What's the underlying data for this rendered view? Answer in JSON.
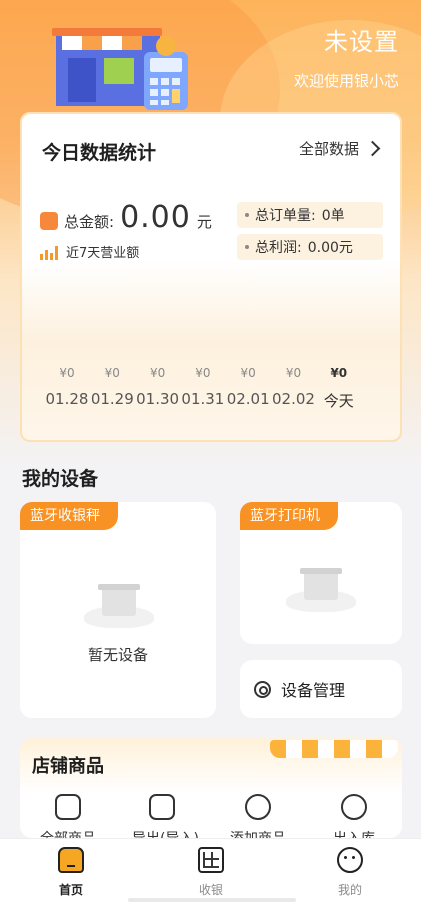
{
  "header": {
    "title": "未设置",
    "subtitle": "欢迎使用银小芯"
  },
  "stats": {
    "title": "今日数据统计",
    "all_data_link": "全部数据",
    "total_label": "总金额:",
    "total_value": "0.00",
    "total_unit": "元",
    "week_label": "近7天营业额",
    "orders_label": "总订单量:",
    "orders_value": "0单",
    "profit_label": "总利润:",
    "profit_value": "0.00元"
  },
  "chart_data": {
    "type": "bar",
    "categories": [
      "01.28",
      "01.29",
      "01.30",
      "01.31",
      "02.01",
      "02.02",
      "今天"
    ],
    "values": [
      0,
      0,
      0,
      0,
      0,
      0,
      0
    ],
    "value_labels": [
      "¥0",
      "¥0",
      "¥0",
      "¥0",
      "¥0",
      "¥0",
      "¥0"
    ]
  },
  "devices": {
    "section_title": "我的设备",
    "scale_tag": "蓝牙收银秤",
    "printer_tag": "蓝牙打印机",
    "no_device": "暂无设备",
    "management": "设备管理"
  },
  "goods": {
    "section_title": "店铺商品",
    "items": [
      "全部商品",
      "导出(导入)",
      "添加商品",
      "出入库"
    ]
  },
  "tabbar": {
    "items": [
      {
        "label": "首页",
        "icon": "home-icon",
        "active": true
      },
      {
        "label": "收银",
        "icon": "cashier-icon",
        "active": false
      },
      {
        "label": "我的",
        "icon": "profile-icon",
        "active": false
      }
    ]
  },
  "colors": {
    "accent": "#f99224",
    "header_gradient": "#fdb35a"
  }
}
